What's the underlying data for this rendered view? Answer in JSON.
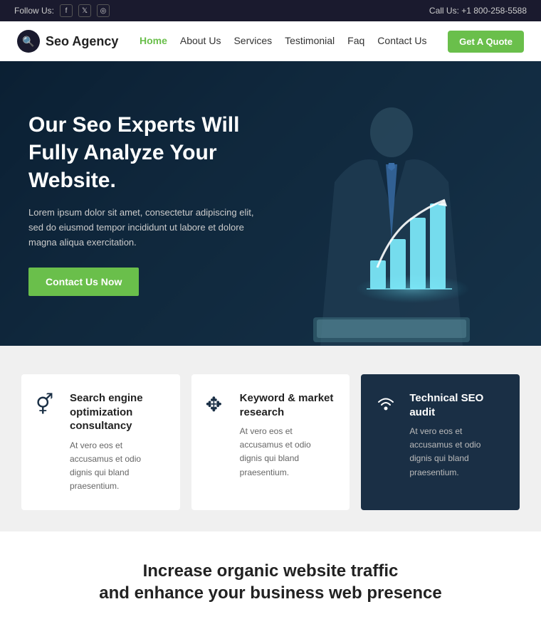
{
  "topbar": {
    "follow_label": "Follow Us:",
    "call_label": "Call Us: +1 800-258-5588",
    "socials": [
      "f",
      "t",
      "i"
    ]
  },
  "navbar": {
    "logo_text": "Seo Agency",
    "links": [
      {
        "label": "Home",
        "active": true
      },
      {
        "label": "About Us",
        "active": false
      },
      {
        "label": "Services",
        "active": false
      },
      {
        "label": "Testimonial",
        "active": false
      },
      {
        "label": "Faq",
        "active": false
      },
      {
        "label": "Contact Us",
        "active": false
      }
    ],
    "cta_label": "Get A Quote"
  },
  "hero": {
    "headline": "Our Seo Experts Will Fully Analyze Your Website.",
    "body": "Lorem ipsum dolor sit amet, consectetur adipiscing elit, sed do eiusmod tempor incididunt ut labore et dolore magna aliqua exercitation.",
    "cta_label": "Contact Us Now"
  },
  "services": [
    {
      "icon": "gender",
      "title": "Search engine optimization consultancy",
      "text": "At vero eos et accusamus et odio dignis qui bland praesentium.",
      "dark": false
    },
    {
      "icon": "move",
      "title": "Keyword & market research",
      "text": "At vero eos et accusamus et odio dignis qui bland praesentium.",
      "dark": false
    },
    {
      "icon": "wifi",
      "title": "Technical SEO audit",
      "text": "At vero eos et accusamus et odio dignis qui bland praesentium.",
      "dark": true
    }
  ],
  "teaser": {
    "headline": "Increase organic website traffic",
    "subheadline": "and enhance your business web presence"
  }
}
